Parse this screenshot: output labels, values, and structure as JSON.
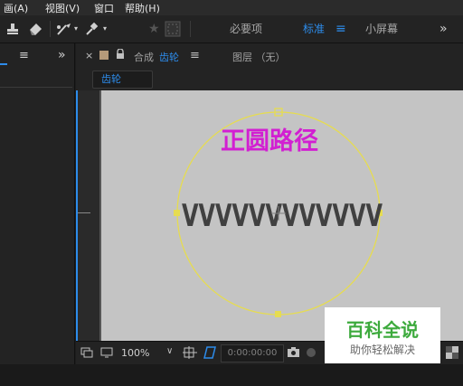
{
  "menu": {
    "items": [
      "画(A)",
      "视图(V)",
      "窗口",
      "帮助(H)"
    ]
  },
  "workspace": {
    "items": [
      "必要项",
      "标准",
      "小屏幕"
    ],
    "active": "标准",
    "menu_icon": "≡",
    "more_icon": "»"
  },
  "composition_panel": {
    "close_icon": "×",
    "tab_prefix": "合成",
    "comp_name": "齿轮",
    "menu_icon": "≡",
    "layer_label": "图层 （无）",
    "comp_tab_label": "齿轮"
  },
  "left_panel": {
    "menu_icon": "≡",
    "more_icon": "»"
  },
  "canvas": {
    "title_text": "正圆路径",
    "wave_text": "VVVVVVVVVVVV",
    "title_color": "#d21fd2",
    "wave_color": "#404040",
    "path_color": "#e6dc50"
  },
  "viewer_controls": {
    "zoom": "100%",
    "timecode": "0:00:00:00"
  },
  "watermark": {
    "title": "百科全说",
    "subtitle": "助你轻松解决",
    "color": "#3daa3d"
  }
}
